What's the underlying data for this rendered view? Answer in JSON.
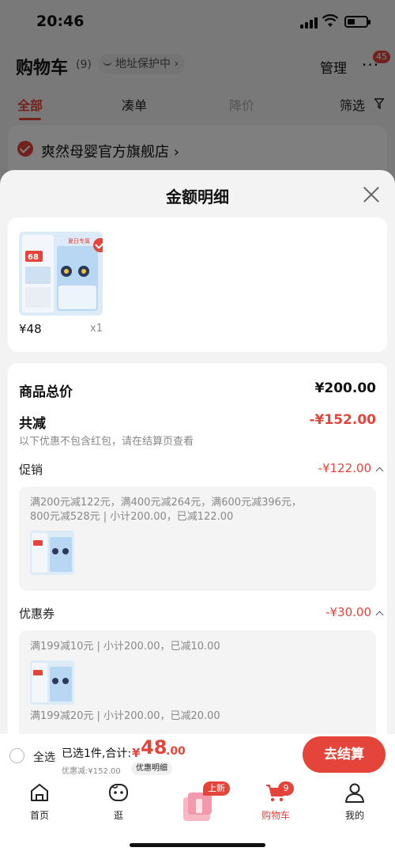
{
  "status_bar": {
    "time": "20:46"
  },
  "cart_header": {
    "title": "购物车",
    "count": "(9)",
    "address_protect": "地址保护中 ›",
    "manage": "管理",
    "more_badge": "45"
  },
  "cart_tabs": {
    "all": "全部",
    "combine": "凑单",
    "price": "降价",
    "filter": "筛选"
  },
  "store": {
    "name": "爽然母婴官方旗舰店 ›"
  },
  "sheet": {
    "title": "金额明细",
    "product": {
      "price": "¥48",
      "qty": "x1"
    },
    "total_label": "商品总价",
    "total_value": "¥200.00",
    "reduce_label": "共减",
    "reduce_value": "-¥152.00",
    "reduce_note": "以下优惠不包含红包，请在结算页查看",
    "promo": {
      "label": "促销",
      "value": "-¥122.00",
      "line1": "满200元减122元，满400元减264元，满600元减396元，",
      "line2": "800元减528元 | 小计200.00，已减122.00"
    },
    "coupon": {
      "label": "优惠券",
      "value": "-¥30.00",
      "rule1": "满199减10元 | 小计200.00，已减10.00",
      "rule2": "满199减20元 | 小计200.00，已减20.00"
    }
  },
  "checkout": {
    "select_all": "全选",
    "summary": "已选1件,合计:",
    "yen": "¥",
    "amount_int": "48",
    "amount_dec": ".00",
    "discount": "优惠减:¥152.00",
    "detail_btn": "优惠明细",
    "button": "去结算"
  },
  "tabbar": {
    "home": "首页",
    "browse": "逛",
    "promo_badge": "上新",
    "cart": "购物车",
    "cart_badge": "9",
    "me": "我的"
  },
  "colors": {
    "accent": "#e5443a",
    "sheet_bg": "#f3f3f3"
  },
  "icons": [
    "signal-icon",
    "wifi-icon",
    "battery-icon",
    "close-icon",
    "check-icon",
    "chevron-up-icon",
    "home-icon",
    "browse-icon",
    "cart-icon",
    "user-icon",
    "filter-icon"
  ]
}
